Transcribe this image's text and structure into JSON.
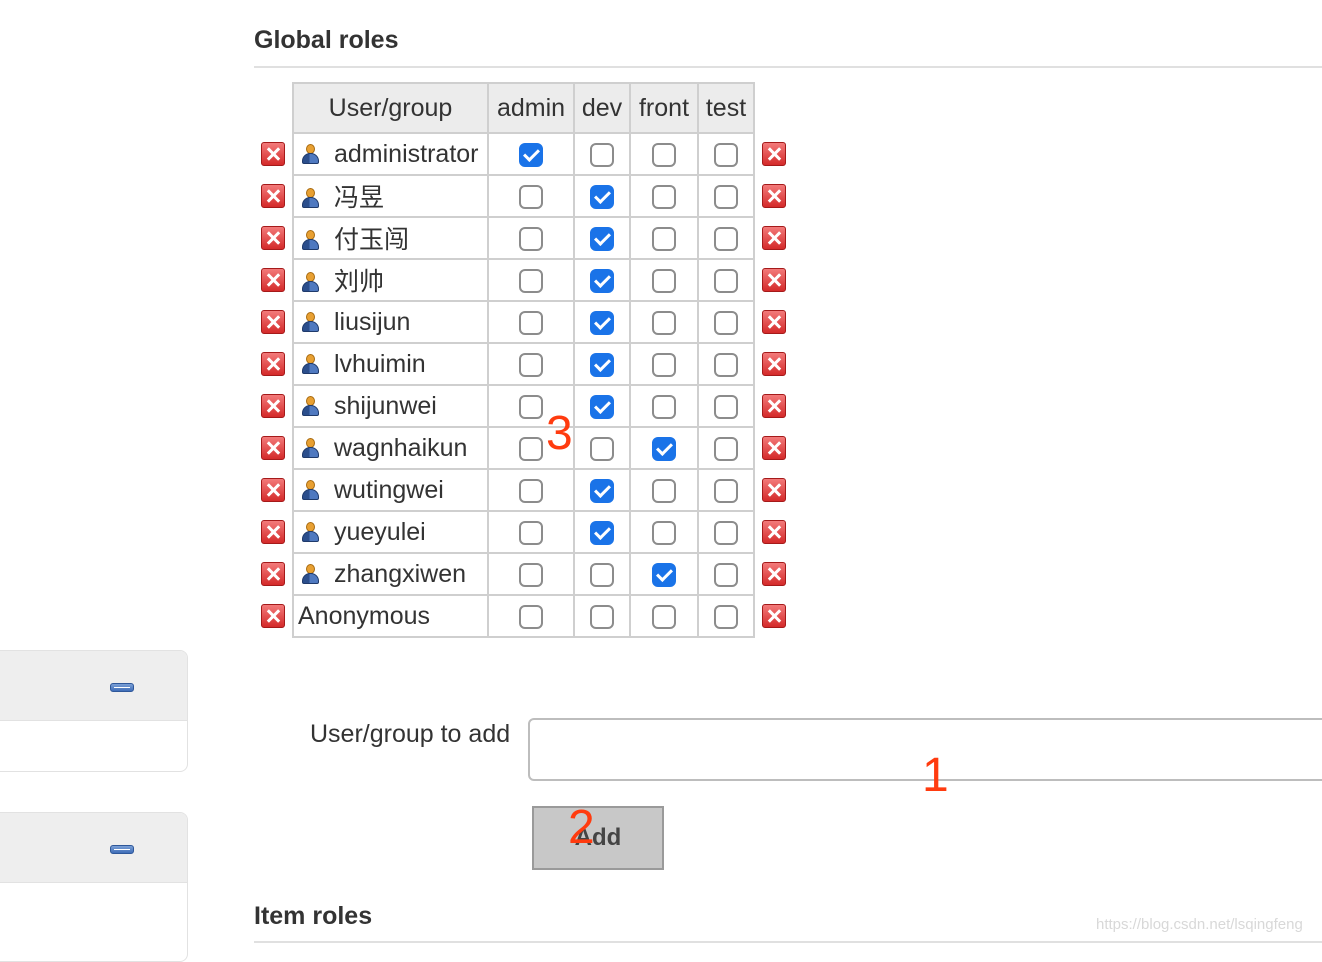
{
  "global_roles": {
    "title": "Global roles",
    "columns": [
      "User/group",
      "admin",
      "dev",
      "front",
      "test"
    ],
    "rows": [
      {
        "name": "administrator",
        "user_icon": "user-icon",
        "admin": true,
        "dev": false,
        "front": false,
        "test": false
      },
      {
        "name": "冯昱",
        "user_icon": "user-icon",
        "admin": false,
        "dev": true,
        "front": false,
        "test": false
      },
      {
        "name": "付玉闯",
        "user_icon": "user-icon",
        "admin": false,
        "dev": true,
        "front": false,
        "test": false
      },
      {
        "name": "刘帅",
        "user_icon": "user-icon",
        "admin": false,
        "dev": true,
        "front": false,
        "test": false
      },
      {
        "name": "liusijun",
        "user_icon": "user-icon",
        "admin": false,
        "dev": true,
        "front": false,
        "test": false
      },
      {
        "name": "lvhuimin",
        "user_icon": "user-icon",
        "admin": false,
        "dev": true,
        "front": false,
        "test": false
      },
      {
        "name": "shijunwei",
        "user_icon": "user-icon",
        "admin": false,
        "dev": true,
        "front": false,
        "test": false
      },
      {
        "name": "wagnhaikun",
        "user_icon": "user-icon",
        "admin": false,
        "dev": false,
        "front": true,
        "test": false
      },
      {
        "name": "wutingwei",
        "user_icon": "user-icon",
        "admin": false,
        "dev": true,
        "front": false,
        "test": false
      },
      {
        "name": "yueyulei",
        "user_icon": "user-icon",
        "admin": false,
        "dev": true,
        "front": false,
        "test": false
      },
      {
        "name": "zhangxiwen",
        "user_icon": "user-icon",
        "admin": false,
        "dev": false,
        "front": true,
        "test": false
      },
      {
        "name": "Anonymous",
        "user_icon": null,
        "admin": false,
        "dev": false,
        "front": false,
        "test": false
      }
    ]
  },
  "add_form": {
    "label": "User/group to add",
    "input_value": "",
    "button_label": "Add"
  },
  "item_roles": {
    "title": "Item roles"
  },
  "annotations": [
    "1",
    "2",
    "3"
  ],
  "watermark": "https://blog.csdn.net/lsqingfeng",
  "colors": {
    "checkbox_checked": "#1a73e8",
    "delete_icon": "#d42a2a",
    "annotation": "#ff3b0f",
    "header_bg": "#ececec"
  },
  "icons": {
    "row_delete": "delete-icon",
    "panel_collapse": "minus-icon",
    "user": "user-icon"
  }
}
